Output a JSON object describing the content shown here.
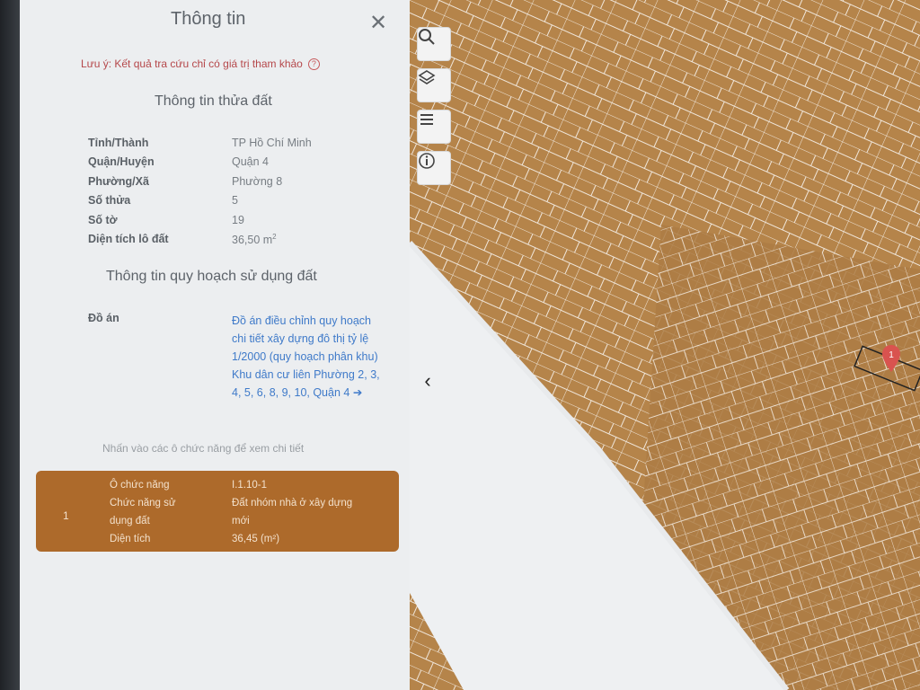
{
  "panel": {
    "title": "Thông tin",
    "note": "Lưu ý: Kết quả tra cứu chỉ có giá trị tham khảo",
    "section1_title": "Thông tin thửa đất",
    "parcel": [
      {
        "label": "Tỉnh/Thành",
        "value": "TP Hồ Chí Minh"
      },
      {
        "label": "Quận/Huyện",
        "value": "Quận 4"
      },
      {
        "label": "Phường/Xã",
        "value": "Phường 8"
      },
      {
        "label": "Số thửa",
        "value": "5"
      },
      {
        "label": "Số tờ",
        "value": "19"
      },
      {
        "label": "Diện tích lô đất",
        "value": "36,50 m",
        "sup": "2"
      }
    ],
    "section2_title": "Thông tin quy hoạch sử dụng đất",
    "doan_label": "Đồ án",
    "doan_link": "Đồ án điều chỉnh quy hoạch chi tiết xây dựng đô thị tỷ lệ 1/2000 (quy hoạch phân khu) Khu dân cư liên Phường 2, 3, 4, 5, 6, 8, 9, 10, Quận 4",
    "doan_arrow": "➔",
    "hint": "Nhấn vào các ô chức năng để xem chi tiết",
    "zone": {
      "index": "1",
      "rows": [
        {
          "label": "Ô chức năng",
          "value": "I.1.10-1"
        },
        {
          "label": "Chức năng sử",
          "value": "Đất nhóm nhà ở xây dựng"
        },
        {
          "label": "dụng đất",
          "value": "mới"
        },
        {
          "label": "Diện tích",
          "value": "36,45 (m²)"
        }
      ]
    }
  },
  "map": {
    "collapse_icon": "chevron-left-icon",
    "tools": [
      "search-icon",
      "layers-icon",
      "list-icon",
      "info-icon"
    ],
    "marker_label": "1",
    "colors": {
      "land": "#b5844a",
      "road": "#eef0f2",
      "marker": "#d9534f"
    }
  },
  "colors": {
    "panel_bg": "#eceef0",
    "accent_link": "#3f7ac9",
    "zone_card": "#ad6a2b",
    "note": "#b5474a"
  }
}
